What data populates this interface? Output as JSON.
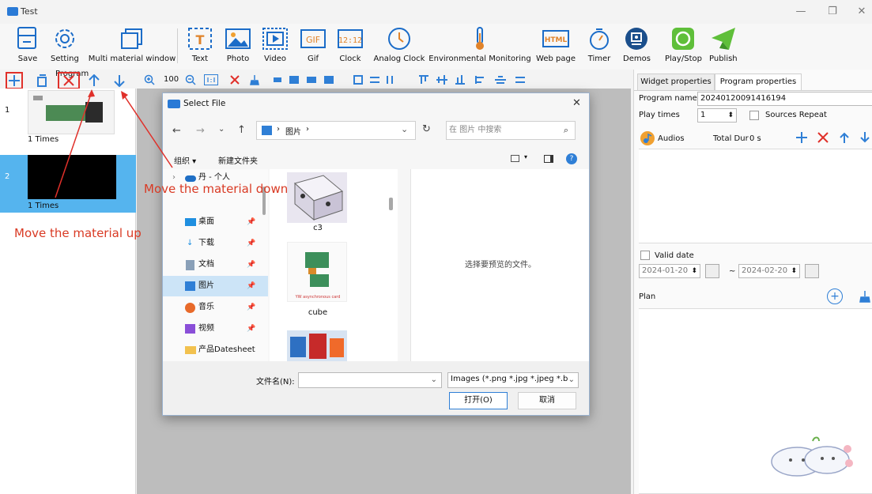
{
  "window": {
    "title": "Test",
    "minimize": "—",
    "restore": "❐",
    "close": "✕"
  },
  "toolbar": {
    "save": "Save",
    "setting": "Setting",
    "multi_material": "Multi material window",
    "text": "Text",
    "photo": "Photo",
    "video": "Video",
    "gif": "Gif",
    "clock": "Clock",
    "analog_clock": "Analog Clock",
    "env_monitoring": "Environmental Monitoring",
    "web_page": "Web page",
    "timer": "Timer",
    "demos": "Demos",
    "play_stop": "Play/Stop",
    "publish": "Publish",
    "gif_icon_text": "GIF",
    "clock_icon_text": "12:12",
    "html_icon_text": "HTML",
    "text_icon_text": "T"
  },
  "bar2": {
    "program_label": "Program",
    "zoom_value": "100"
  },
  "programs": [
    {
      "number": "1",
      "times": "1 Times"
    },
    {
      "number": "2",
      "times": "1 Times"
    }
  ],
  "right": {
    "tab_widget": "Widget properties",
    "tab_program": "Program properties",
    "program_name_label": "Program name",
    "program_name_value": "20240120091416194",
    "play_times_label": "Play times",
    "play_times_value": "1",
    "sources_repeat": "Sources Repeat",
    "audios_label": "Audios",
    "total_dur": "Total Dur",
    "total_dur_value": "0 s",
    "valid_date": "Valid date",
    "date_from": "2024-01-20",
    "date_to": "2024-02-20",
    "date_sep": "~",
    "plan_label": "Plan"
  },
  "dialog": {
    "title": "Select File",
    "path_segment": "图片",
    "path_sep": "›",
    "search_placeholder": "在 图片 中搜索",
    "organize": "组织 ▾",
    "new_folder": "新建文件夹",
    "tree": [
      {
        "label": "丹 - 个人",
        "icon": "cloud-icon"
      },
      {
        "label": "桌面",
        "icon": "desktop-icon"
      },
      {
        "label": "下载",
        "icon": "download-icon"
      },
      {
        "label": "文档",
        "icon": "documents-icon"
      },
      {
        "label": "图片",
        "icon": "pictures-icon"
      },
      {
        "label": "音乐",
        "icon": "music-icon"
      },
      {
        "label": "视频",
        "icon": "videos-icon"
      },
      {
        "label": "产品Datesheet",
        "icon": "folder-icon"
      }
    ],
    "files": [
      {
        "name": "c3"
      },
      {
        "name": "cube"
      }
    ],
    "preview_text": "选择要预览的文件。",
    "filename_label": "文件名(N):",
    "filename_value": "",
    "filetype": "Images (*.png *.jpg *.jpeg *.b",
    "open_button": "打开(O)",
    "cancel_button": "取消"
  },
  "annotations": {
    "down": "Move the material down",
    "up": "Move the material up"
  },
  "colors": {
    "accent": "#2f7fd6",
    "selected": "#55b4ee",
    "annotation": "#d93a24"
  }
}
